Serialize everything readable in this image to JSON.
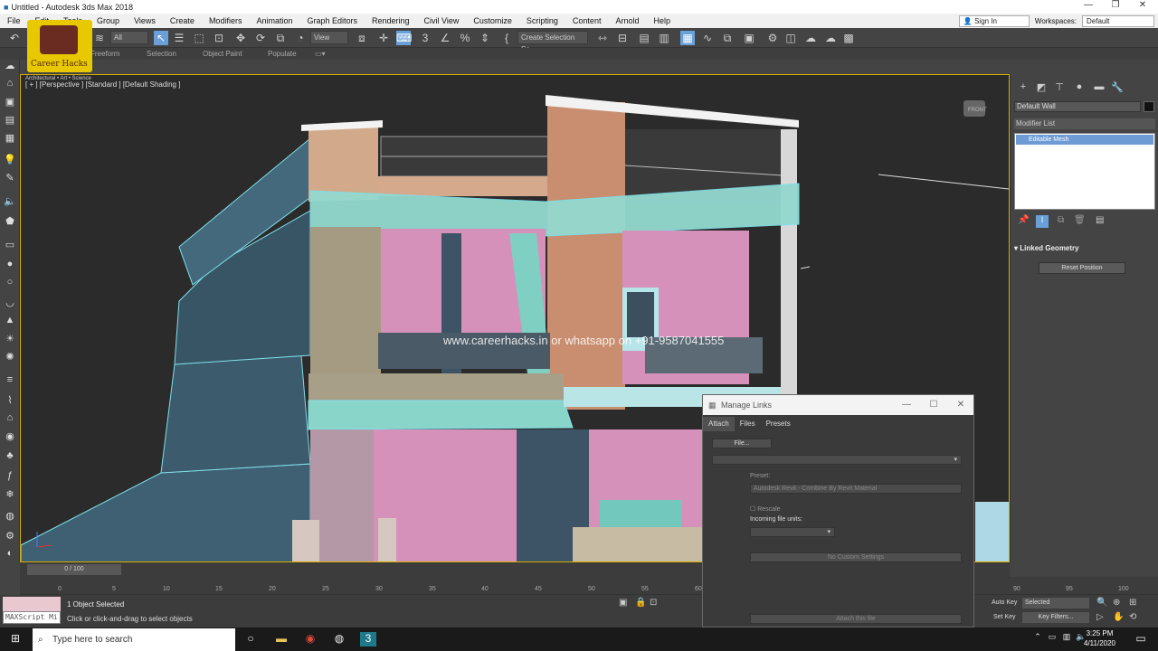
{
  "window": {
    "title": "Untitled - Autodesk 3ds Max 2018",
    "controls": [
      "—",
      "❐",
      "✕"
    ]
  },
  "menu": {
    "items": [
      "File",
      "Edit",
      "Tools",
      "Group",
      "Views",
      "Create",
      "Modifiers",
      "Animation",
      "Graph Editors",
      "Rendering",
      "Civil View",
      "Customize",
      "Scripting",
      "Content",
      "Arnold",
      "Help"
    ],
    "sign_in": "Sign In",
    "workspaces_label": "Workspaces:",
    "workspaces_value": "Default"
  },
  "toolbar": {
    "selection_filter": "All",
    "ref_coord": "View",
    "named_selection": "Create Selection Se"
  },
  "ribbon": {
    "tabs": [
      "Freeform",
      "Selection",
      "Object Paint",
      "Populate"
    ]
  },
  "logo": {
    "text": "Career Hacks",
    "subtitle": "Architectural • Art • Science"
  },
  "viewport": {
    "label": "[ + ] [Perspective ] [Standard ] [Default Shading ]",
    "watermark": "www.careerhacks.in or whatsapp on +91-9587041555",
    "viewcube_label": "FRONT"
  },
  "command_panel": {
    "object_name": "Default Wall",
    "modifier_list": "Modifier List",
    "stack_item": "Editable Mesh",
    "rollout_title": "Linked Geometry",
    "reset_button": "Reset Position"
  },
  "dialog": {
    "title": "Manage Links",
    "tabs": [
      "Attach",
      "Files",
      "Presets"
    ],
    "file_button": "File...",
    "preset_label": "Preset:",
    "preset_value": "Autodesk Revit - Combine By Revit Material",
    "rescale_label": "Rescale",
    "units_label": "Incoming file units:",
    "custom_settings": "No Custom Settings",
    "attach_button": "Attach this file"
  },
  "timeline": {
    "frame": "0 / 100",
    "ticks": [
      "0",
      "5",
      "10",
      "15",
      "20",
      "25",
      "30",
      "35",
      "40",
      "45",
      "50",
      "55",
      "60",
      "90",
      "95",
      "100"
    ]
  },
  "status": {
    "selection": "1 Object Selected",
    "hint": "Click or click-and-drag to select objects",
    "maxscript": "MAXScript Mi",
    "auto_key": "Auto Key",
    "selected": "Selected",
    "set_key": "Set Key",
    "key_filters": "Key Filters..."
  },
  "taskbar": {
    "search_placeholder": "Type here to search",
    "time": "3:25 PM",
    "date": "4/11/2020"
  }
}
